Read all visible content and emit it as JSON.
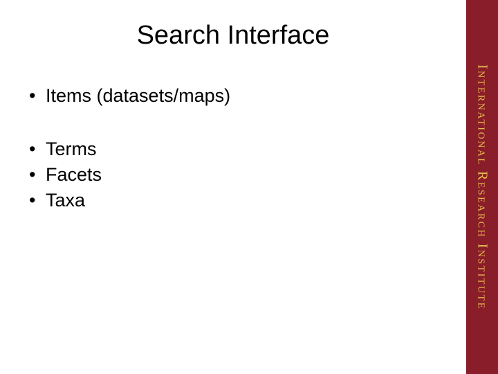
{
  "title": "Search Interface",
  "bullets": {
    "group1": [
      "Items (datasets/maps)"
    ],
    "group2": [
      "Terms",
      "Facets",
      "Taxa"
    ]
  },
  "sidebar": {
    "label": "International Research Institute"
  },
  "colors": {
    "sidebar_bg": "#8a1d2a",
    "sidebar_text": "#e6b94f"
  }
}
